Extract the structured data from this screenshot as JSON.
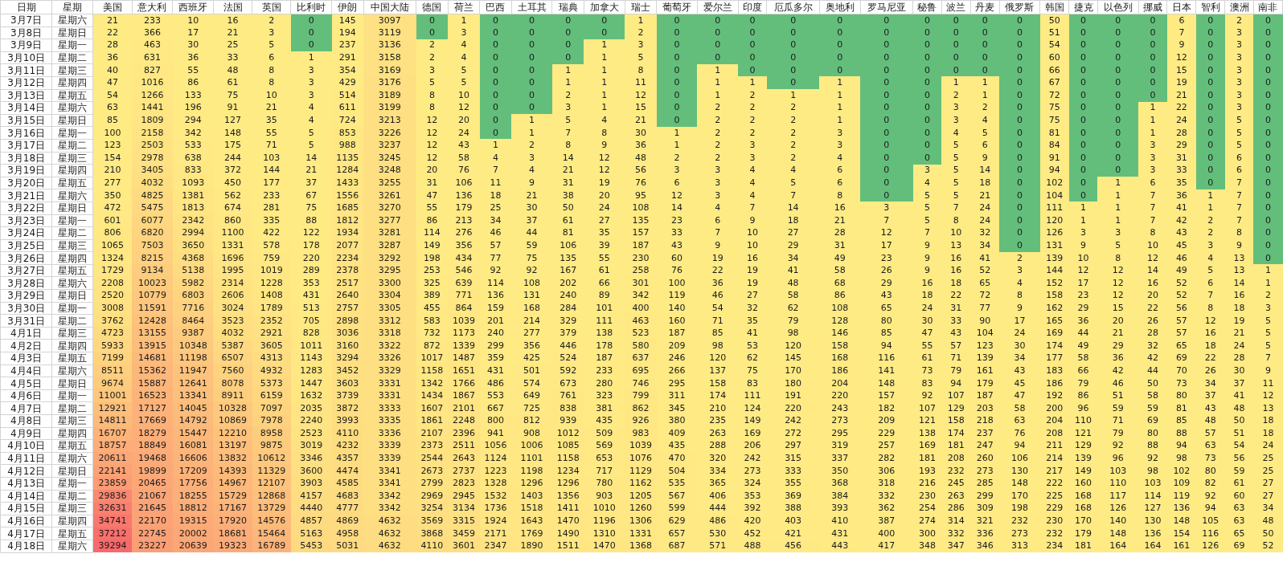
{
  "table": {
    "columns": [
      {
        "header": "日期",
        "kind": "date",
        "cells": [
          "3月7日",
          "3月8日",
          "3月9日",
          "3月10日",
          "3月11日",
          "3月12日",
          "3月13日",
          "3月14日",
          "3月15日",
          "3月16日",
          "3月17日",
          "3月18日",
          "3月19日",
          "3月20日",
          "3月21日",
          "3月22日",
          "3月23日",
          "3月24日",
          "3月25日",
          "3月26日",
          "3月27日",
          "3月28日",
          "3月29日",
          "3月30日",
          "3月31日",
          "4月1日",
          "4月2日",
          "4月3日",
          "4月4日",
          "4月5日",
          "4月6日",
          "4月7日",
          "4月8日",
          "4月9日",
          "4月10日",
          "4月11日",
          "4月12日",
          "4月13日",
          "4月14日",
          "4月15日",
          "4月16日",
          "4月17日",
          "4月18日"
        ]
      },
      {
        "header": "星期",
        "kind": "weekday",
        "cells": [
          "星期六",
          "星期日",
          "星期一",
          "星期二",
          "星期三",
          "星期四",
          "星期五",
          "星期六",
          "星期日",
          "星期一",
          "星期二",
          "星期三",
          "星期四",
          "星期五",
          "星期六",
          "星期日",
          "星期一",
          "星期二",
          "星期三",
          "星期四",
          "星期五",
          "星期六",
          "星期日",
          "星期一",
          "星期二",
          "星期三",
          "星期四",
          "星期五",
          "星期六",
          "星期日",
          "星期一",
          "星期二",
          "星期三",
          "星期四",
          "星期五",
          "星期六",
          "星期日",
          "星期一",
          "星期二",
          "星期三",
          "星期四",
          "星期五",
          "星期六"
        ]
      },
      {
        "header": "美国",
        "kind": "count",
        "cells": [
          "21",
          "22",
          "28",
          "36",
          "40",
          "47",
          "54",
          "63",
          "85",
          "100",
          "123",
          "154",
          "210",
          "277",
          "350",
          "472",
          "601",
          "806",
          "1065",
          "1324",
          "1729",
          "2208",
          "2520",
          "3008",
          "3762",
          "4723",
          "5933",
          "7199",
          "8511",
          "9674",
          "11001",
          "12921",
          "14811",
          "16707",
          "18757",
          "20611",
          "22141",
          "23859",
          "29836",
          "32631",
          "34741",
          "37212",
          "39294"
        ]
      },
      {
        "header": "意大利",
        "kind": "count",
        "cells": [
          "233",
          "366",
          "463",
          "631",
          "827",
          "1016",
          "1266",
          "1441",
          "1809",
          "2158",
          "2503",
          "2978",
          "3405",
          "4032",
          "4825",
          "5475",
          "6077",
          "6820",
          "7503",
          "8215",
          "9134",
          "10023",
          "10779",
          "11591",
          "12428",
          "13155",
          "13915",
          "14681",
          "15362",
          "15887",
          "16523",
          "17127",
          "17669",
          "18279",
          "18849",
          "19468",
          "19899",
          "20465",
          "21067",
          "21645",
          "22170",
          "22745",
          "23227"
        ]
      },
      {
        "header": "西班牙",
        "kind": "count",
        "cells": [
          "10",
          "17",
          "30",
          "36",
          "55",
          "86",
          "133",
          "196",
          "294",
          "342",
          "533",
          "638",
          "833",
          "1093",
          "1381",
          "1813",
          "2342",
          "2994",
          "3650",
          "4368",
          "5138",
          "5982",
          "6803",
          "7716",
          "8464",
          "9387",
          "10348",
          "11198",
          "11947",
          "12641",
          "13341",
          "14045",
          "14792",
          "15447",
          "16081",
          "16606",
          "17209",
          "17756",
          "18255",
          "18812",
          "19315",
          "20002",
          "20639"
        ]
      },
      {
        "header": "法国",
        "kind": "count",
        "cells": [
          "16",
          "21",
          "25",
          "33",
          "48",
          "61",
          "75",
          "91",
          "127",
          "148",
          "175",
          "244",
          "372",
          "450",
          "562",
          "674",
          "860",
          "1100",
          "1331",
          "1696",
          "1995",
          "2314",
          "2606",
          "3024",
          "3523",
          "4032",
          "5387",
          "6507",
          "7560",
          "8078",
          "8911",
          "10328",
          "10869",
          "12210",
          "13197",
          "13832",
          "14393",
          "14967",
          "15729",
          "17167",
          "17920",
          "18681",
          "19323"
        ]
      },
      {
        "header": "英国",
        "kind": "count",
        "cells": [
          "2",
          "3",
          "5",
          "6",
          "8",
          "8",
          "10",
          "21",
          "35",
          "55",
          "71",
          "103",
          "144",
          "177",
          "233",
          "281",
          "335",
          "422",
          "578",
          "759",
          "1019",
          "1228",
          "1408",
          "1789",
          "2352",
          "2921",
          "3605",
          "4313",
          "4932",
          "5373",
          "6159",
          "7097",
          "7978",
          "8958",
          "9875",
          "10612",
          "11329",
          "12107",
          "12868",
          "13729",
          "14576",
          "15464",
          "16789"
        ]
      },
      {
        "header": "比利时",
        "kind": "count",
        "cells": [
          "0",
          "0",
          "0",
          "1",
          "3",
          "3",
          "3",
          "4",
          "4",
          "5",
          "5",
          "14",
          "21",
          "37",
          "67",
          "75",
          "88",
          "122",
          "178",
          "220",
          "289",
          "353",
          "431",
          "513",
          "705",
          "828",
          "1011",
          "1143",
          "1283",
          "1447",
          "1632",
          "2035",
          "2240",
          "2523",
          "3019",
          "3346",
          "3600",
          "3903",
          "4157",
          "4440",
          "4857",
          "5163",
          "5453"
        ]
      },
      {
        "header": "伊朗",
        "kind": "count",
        "cells": [
          "145",
          "194",
          "237",
          "291",
          "354",
          "429",
          "514",
          "611",
          "724",
          "853",
          "988",
          "1135",
          "1284",
          "1433",
          "1556",
          "1685",
          "1812",
          "1934",
          "2077",
          "2234",
          "2378",
          "2517",
          "2640",
          "2757",
          "2898",
          "3036",
          "3160",
          "3294",
          "3452",
          "3603",
          "3739",
          "3872",
          "3993",
          "4110",
          "4232",
          "4357",
          "4474",
          "4585",
          "4683",
          "4777",
          "4869",
          "4958",
          "5031"
        ]
      },
      {
        "header": "中国大陆",
        "kind": "count",
        "cells": [
          "3097",
          "3119",
          "3136",
          "3158",
          "3169",
          "3176",
          "3189",
          "3199",
          "3213",
          "3226",
          "3237",
          "3245",
          "3248",
          "3255",
          "3261",
          "3270",
          "3277",
          "3281",
          "3287",
          "3292",
          "3295",
          "3300",
          "3304",
          "3305",
          "3312",
          "3318",
          "3322",
          "3326",
          "3329",
          "3331",
          "3331",
          "3333",
          "3335",
          "3336",
          "3339",
          "3339",
          "3341",
          "3341",
          "3342",
          "3342",
          "4632",
          "4632",
          "4632"
        ]
      },
      {
        "header": "德国",
        "kind": "count",
        "cells": [
          "0",
          "0",
          "2",
          "2",
          "3",
          "5",
          "8",
          "8",
          "12",
          "12",
          "12",
          "12",
          "20",
          "31",
          "47",
          "55",
          "86",
          "114",
          "149",
          "198",
          "253",
          "325",
          "389",
          "455",
          "583",
          "732",
          "872",
          "1017",
          "1158",
          "1342",
          "1434",
          "1607",
          "1861",
          "2107",
          "2373",
          "2544",
          "2673",
          "2799",
          "2969",
          "3254",
          "3569",
          "3868",
          "4110"
        ]
      },
      {
        "header": "荷兰",
        "kind": "count",
        "cells": [
          "1",
          "3",
          "4",
          "4",
          "5",
          "5",
          "10",
          "12",
          "20",
          "24",
          "43",
          "58",
          "76",
          "106",
          "136",
          "179",
          "213",
          "276",
          "356",
          "434",
          "546",
          "639",
          "771",
          "864",
          "1039",
          "1173",
          "1339",
          "1487",
          "1651",
          "1766",
          "1867",
          "2101",
          "2248",
          "2396",
          "2511",
          "2643",
          "2737",
          "2823",
          "2945",
          "3134",
          "3315",
          "3459",
          "3601"
        ]
      },
      {
        "header": "巴西",
        "kind": "count",
        "cells": [
          "0",
          "0",
          "0",
          "0",
          "0",
          "0",
          "0",
          "0",
          "0",
          "0",
          "1",
          "4",
          "7",
          "11",
          "18",
          "25",
          "34",
          "46",
          "57",
          "77",
          "92",
          "114",
          "136",
          "159",
          "201",
          "240",
          "299",
          "359",
          "431",
          "486",
          "553",
          "667",
          "800",
          "941",
          "1056",
          "1124",
          "1223",
          "1328",
          "1532",
          "1736",
          "1924",
          "2171",
          "2347"
        ]
      },
      {
        "header": "土耳其",
        "kind": "count",
        "cells": [
          "0",
          "0",
          "0",
          "0",
          "0",
          "0",
          "0",
          "0",
          "1",
          "1",
          "2",
          "3",
          "4",
          "9",
          "21",
          "30",
          "37",
          "44",
          "59",
          "75",
          "92",
          "108",
          "131",
          "168",
          "214",
          "277",
          "356",
          "425",
          "501",
          "574",
          "649",
          "725",
          "812",
          "908",
          "1006",
          "1101",
          "1198",
          "1296",
          "1403",
          "1518",
          "1643",
          "1769",
          "1890"
        ]
      },
      {
        "header": "瑞典",
        "kind": "count",
        "cells": [
          "0",
          "0",
          "0",
          "0",
          "1",
          "1",
          "2",
          "3",
          "5",
          "7",
          "8",
          "14",
          "21",
          "31",
          "38",
          "50",
          "61",
          "81",
          "106",
          "135",
          "167",
          "202",
          "240",
          "284",
          "329",
          "379",
          "446",
          "524",
          "592",
          "673",
          "761",
          "838",
          "939",
          "1012",
          "1085",
          "1158",
          "1234",
          "1296",
          "1356",
          "1411",
          "1470",
          "1490",
          "1511"
        ]
      },
      {
        "header": "加拿大",
        "kind": "count",
        "cells": [
          "0",
          "0",
          "1",
          "1",
          "1",
          "1",
          "1",
          "1",
          "4",
          "8",
          "9",
          "12",
          "12",
          "19",
          "20",
          "24",
          "27",
          "35",
          "39",
          "55",
          "61",
          "66",
          "89",
          "101",
          "111",
          "138",
          "178",
          "187",
          "233",
          "280",
          "323",
          "381",
          "435",
          "509",
          "569",
          "653",
          "717",
          "780",
          "903",
          "1010",
          "1196",
          "1310",
          "1470"
        ]
      },
      {
        "header": "瑞士",
        "kind": "count",
        "cells": [
          "1",
          "2",
          "3",
          "5",
          "8",
          "11",
          "12",
          "15",
          "21",
          "30",
          "36",
          "48",
          "56",
          "76",
          "95",
          "108",
          "135",
          "157",
          "187",
          "230",
          "258",
          "301",
          "342",
          "400",
          "463",
          "523",
          "580",
          "637",
          "695",
          "746",
          "799",
          "862",
          "926",
          "983",
          "1039",
          "1076",
          "1129",
          "1162",
          "1205",
          "1260",
          "1306",
          "1331",
          "1368"
        ]
      },
      {
        "header": "葡萄牙",
        "kind": "count",
        "cells": [
          "0",
          "0",
          "0",
          "0",
          "0",
          "0",
          "0",
          "0",
          "0",
          "1",
          "1",
          "2",
          "3",
          "6",
          "12",
          "14",
          "23",
          "33",
          "43",
          "60",
          "76",
          "100",
          "119",
          "140",
          "160",
          "187",
          "209",
          "246",
          "266",
          "295",
          "311",
          "345",
          "380",
          "409",
          "435",
          "470",
          "504",
          "535",
          "567",
          "599",
          "629",
          "657",
          "687"
        ]
      },
      {
        "header": "爱尔兰",
        "kind": "count",
        "cells": [
          "0",
          "0",
          "0",
          "0",
          "1",
          "1",
          "1",
          "2",
          "2",
          "2",
          "2",
          "2",
          "3",
          "3",
          "3",
          "4",
          "6",
          "7",
          "9",
          "19",
          "22",
          "36",
          "46",
          "54",
          "71",
          "85",
          "98",
          "120",
          "137",
          "158",
          "174",
          "210",
          "235",
          "263",
          "288",
          "320",
          "334",
          "365",
          "406",
          "444",
          "486",
          "530",
          "571"
        ]
      },
      {
        "header": "印度",
        "kind": "count",
        "cells": [
          "0",
          "0",
          "0",
          "0",
          "0",
          "1",
          "2",
          "2",
          "2",
          "2",
          "3",
          "3",
          "4",
          "4",
          "4",
          "7",
          "9",
          "10",
          "10",
          "16",
          "19",
          "19",
          "27",
          "32",
          "35",
          "41",
          "53",
          "62",
          "75",
          "83",
          "111",
          "124",
          "149",
          "169",
          "206",
          "242",
          "273",
          "324",
          "353",
          "392",
          "420",
          "452",
          "488"
        ]
      },
      {
        "header": "厄瓜多尔",
        "kind": "count",
        "cells": [
          "0",
          "0",
          "0",
          "0",
          "0",
          "0",
          "1",
          "2",
          "2",
          "2",
          "2",
          "2",
          "4",
          "5",
          "7",
          "14",
          "18",
          "27",
          "29",
          "34",
          "41",
          "48",
          "58",
          "62",
          "79",
          "98",
          "120",
          "145",
          "170",
          "180",
          "191",
          "220",
          "242",
          "272",
          "297",
          "315",
          "333",
          "355",
          "369",
          "388",
          "403",
          "421",
          "456"
        ]
      },
      {
        "header": "奥地利",
        "kind": "count",
        "cells": [
          "0",
          "0",
          "0",
          "0",
          "0",
          "1",
          "1",
          "1",
          "1",
          "3",
          "3",
          "4",
          "6",
          "6",
          "8",
          "16",
          "21",
          "28",
          "31",
          "49",
          "58",
          "68",
          "86",
          "108",
          "128",
          "146",
          "158",
          "168",
          "186",
          "204",
          "220",
          "243",
          "273",
          "295",
          "319",
          "337",
          "350",
          "368",
          "384",
          "393",
          "410",
          "431",
          "443"
        ]
      },
      {
        "header": "罗马尼亚",
        "kind": "count",
        "cells": [
          "0",
          "0",
          "0",
          "0",
          "0",
          "0",
          "0",
          "0",
          "0",
          "0",
          "0",
          "0",
          "0",
          "0",
          "0",
          "3",
          "7",
          "12",
          "17",
          "23",
          "26",
          "29",
          "43",
          "65",
          "80",
          "85",
          "94",
          "116",
          "141",
          "148",
          "157",
          "182",
          "209",
          "229",
          "257",
          "282",
          "306",
          "318",
          "332",
          "362",
          "387",
          "400",
          "417"
        ]
      },
      {
        "header": "秘鲁",
        "kind": "count",
        "cells": [
          "0",
          "0",
          "0",
          "0",
          "0",
          "0",
          "0",
          "0",
          "0",
          "0",
          "0",
          "0",
          "3",
          "4",
          "5",
          "5",
          "5",
          "7",
          "9",
          "9",
          "9",
          "16",
          "18",
          "24",
          "30",
          "47",
          "55",
          "61",
          "73",
          "83",
          "92",
          "107",
          "121",
          "138",
          "169",
          "181",
          "193",
          "216",
          "230",
          "254",
          "274",
          "300",
          "348"
        ]
      },
      {
        "header": "波兰",
        "kind": "count",
        "cells": [
          "0",
          "0",
          "0",
          "0",
          "0",
          "1",
          "2",
          "3",
          "3",
          "4",
          "5",
          "5",
          "5",
          "5",
          "5",
          "7",
          "8",
          "10",
          "13",
          "16",
          "16",
          "18",
          "22",
          "31",
          "33",
          "43",
          "57",
          "71",
          "79",
          "94",
          "107",
          "129",
          "158",
          "174",
          "181",
          "208",
          "232",
          "245",
          "263",
          "286",
          "314",
          "332",
          "347"
        ]
      },
      {
        "header": "丹麦",
        "kind": "count",
        "cells": [
          "0",
          "0",
          "0",
          "0",
          "0",
          "1",
          "1",
          "2",
          "4",
          "5",
          "6",
          "9",
          "14",
          "18",
          "21",
          "24",
          "24",
          "32",
          "34",
          "41",
          "52",
          "65",
          "72",
          "77",
          "90",
          "104",
          "123",
          "139",
          "161",
          "179",
          "187",
          "203",
          "218",
          "237",
          "247",
          "260",
          "273",
          "285",
          "299",
          "309",
          "321",
          "336",
          "346"
        ]
      },
      {
        "header": "俄罗斯",
        "kind": "count",
        "cells": [
          "0",
          "0",
          "0",
          "0",
          "0",
          "0",
          "0",
          "0",
          "0",
          "0",
          "0",
          "0",
          "0",
          "0",
          "0",
          "0",
          "0",
          "0",
          "0",
          "2",
          "3",
          "4",
          "8",
          "9",
          "17",
          "24",
          "30",
          "34",
          "43",
          "45",
          "47",
          "58",
          "63",
          "76",
          "94",
          "106",
          "130",
          "148",
          "170",
          "198",
          "232",
          "273",
          "313"
        ]
      },
      {
        "header": "韩国",
        "kind": "count",
        "cells": [
          "50",
          "51",
          "54",
          "60",
          "66",
          "67",
          "72",
          "75",
          "75",
          "81",
          "84",
          "91",
          "94",
          "102",
          "104",
          "111",
          "120",
          "126",
          "131",
          "139",
          "144",
          "152",
          "158",
          "162",
          "165",
          "169",
          "174",
          "177",
          "183",
          "186",
          "192",
          "200",
          "204",
          "208",
          "211",
          "214",
          "217",
          "222",
          "225",
          "229",
          "230",
          "232",
          "234"
        ]
      },
      {
        "header": "捷克",
        "kind": "count",
        "cells": [
          "0",
          "0",
          "0",
          "0",
          "0",
          "0",
          "0",
          "0",
          "0",
          "0",
          "0",
          "0",
          "0",
          "0",
          "0",
          "1",
          "1",
          "3",
          "9",
          "10",
          "12",
          "17",
          "23",
          "29",
          "36",
          "44",
          "49",
          "58",
          "66",
          "79",
          "86",
          "96",
          "110",
          "121",
          "129",
          "139",
          "149",
          "160",
          "168",
          "168",
          "170",
          "179",
          "181"
        ]
      },
      {
        "header": "以色列",
        "kind": "count",
        "cells": [
          "0",
          "0",
          "0",
          "0",
          "0",
          "0",
          "0",
          "0",
          "0",
          "0",
          "0",
          "0",
          "0",
          "1",
          "1",
          "1",
          "1",
          "3",
          "5",
          "8",
          "12",
          "12",
          "12",
          "15",
          "20",
          "21",
          "29",
          "36",
          "42",
          "46",
          "51",
          "59",
          "71",
          "79",
          "92",
          "96",
          "103",
          "110",
          "117",
          "126",
          "140",
          "148",
          "164"
        ]
      },
      {
        "header": "挪威",
        "kind": "count",
        "cells": [
          "0",
          "0",
          "0",
          "0",
          "0",
          "0",
          "0",
          "1",
          "1",
          "1",
          "3",
          "3",
          "3",
          "6",
          "7",
          "7",
          "7",
          "8",
          "10",
          "12",
          "14",
          "16",
          "20",
          "22",
          "26",
          "28",
          "32",
          "42",
          "44",
          "50",
          "58",
          "59",
          "69",
          "80",
          "88",
          "92",
          "98",
          "103",
          "114",
          "127",
          "130",
          "136",
          "164"
        ]
      },
      {
        "header": "日本",
        "kind": "count",
        "cells": [
          "6",
          "7",
          "9",
          "12",
          "15",
          "19",
          "21",
          "22",
          "24",
          "28",
          "29",
          "31",
          "33",
          "35",
          "36",
          "41",
          "42",
          "43",
          "45",
          "46",
          "49",
          "52",
          "52",
          "56",
          "57",
          "57",
          "65",
          "69",
          "70",
          "73",
          "80",
          "81",
          "85",
          "88",
          "94",
          "98",
          "102",
          "109",
          "119",
          "136",
          "148",
          "154",
          "161"
        ]
      },
      {
        "header": "智利",
        "kind": "count",
        "cells": [
          "0",
          "0",
          "0",
          "0",
          "0",
          "0",
          "0",
          "0",
          "0",
          "0",
          "0",
          "0",
          "0",
          "0",
          "1",
          "1",
          "2",
          "2",
          "3",
          "4",
          "5",
          "6",
          "7",
          "8",
          "12",
          "16",
          "18",
          "22",
          "26",
          "34",
          "37",
          "43",
          "48",
          "57",
          "63",
          "73",
          "80",
          "82",
          "92",
          "94",
          "105",
          "116",
          "126"
        ]
      },
      {
        "header": "澳洲",
        "kind": "count",
        "cells": [
          "2",
          "3",
          "3",
          "3",
          "3",
          "3",
          "3",
          "3",
          "5",
          "5",
          "5",
          "6",
          "6",
          "7",
          "7",
          "7",
          "7",
          "8",
          "9",
          "13",
          "13",
          "14",
          "16",
          "18",
          "19",
          "21",
          "24",
          "28",
          "30",
          "37",
          "41",
          "48",
          "50",
          "51",
          "54",
          "56",
          "59",
          "61",
          "60",
          "63",
          "63",
          "65",
          "69"
        ]
      },
      {
        "header": "南非",
        "kind": "count",
        "cells": [
          "0",
          "0",
          "0",
          "0",
          "0",
          "0",
          "0",
          "0",
          "0",
          "0",
          "0",
          "0",
          "0",
          "0",
          "0",
          "0",
          "0",
          "0",
          "0",
          "0",
          "1",
          "1",
          "2",
          "3",
          "5",
          "5",
          "5",
          "7",
          "9",
          "11",
          "12",
          "13",
          "18",
          "18",
          "24",
          "25",
          "25",
          "27",
          "27",
          "34",
          "48",
          "50",
          "52"
        ]
      }
    ]
  }
}
